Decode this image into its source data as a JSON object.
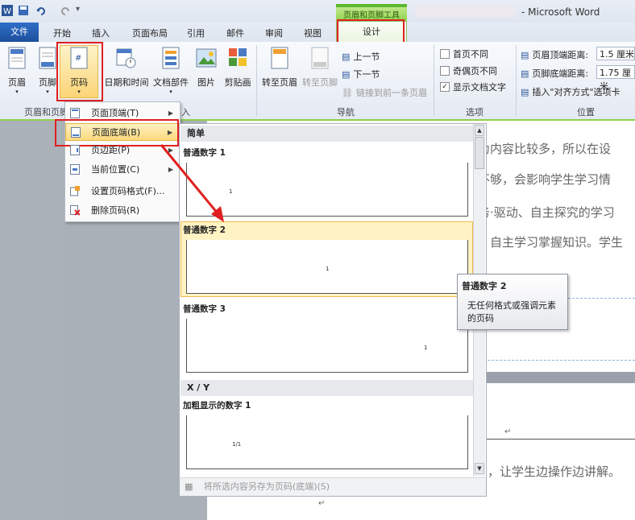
{
  "app": {
    "title": "- Microsoft Word",
    "context_tools_label": "页眉和页脚工具"
  },
  "tabs": {
    "file": "文件",
    "items": [
      "开始",
      "插入",
      "页面布局",
      "引用",
      "邮件",
      "审阅",
      "视图"
    ],
    "design": "设计"
  },
  "ribbon": {
    "header": "页眉",
    "footer": "页脚",
    "page_number": "页码",
    "datetime": "日期和时间",
    "doc_parts": "文档部件",
    "picture": "图片",
    "clipart": "剪贴画",
    "goto_header": "转至页眉",
    "goto_footer": "转至页脚",
    "prev": "上一节",
    "next": "下一节",
    "link_prev": "链接到前一条页眉",
    "group_header_footer": "页眉和页脚",
    "group_insert": "入",
    "group_nav": "导航",
    "opt_first": "首页不同",
    "opt_oddeven": "奇偶页不同",
    "opt_showtext": "显示文档文字",
    "group_options": "选项",
    "header_dist_label": "页眉顶端距离:",
    "header_dist_value": "1.5 厘米",
    "footer_dist_label": "页脚底端距离:",
    "footer_dist_value": "1.75 厘米",
    "insert_align": "插入\"对齐方式\"选项卡",
    "group_position": "位置"
  },
  "menu": [
    {
      "label": "页面顶端(T)",
      "arrow": "▶"
    },
    {
      "label": "页面底端(B)",
      "arrow": "▶"
    },
    {
      "label": "页边距(P)",
      "arrow": "▶"
    },
    {
      "label": "当前位置(C)",
      "arrow": "▶"
    },
    {
      "label": "设置页码格式(F)...",
      "arrow": ""
    },
    {
      "label": "删除页码(R)",
      "arrow": ""
    }
  ],
  "gallery": {
    "cat_simple": "简单",
    "item1": "普通数字 1",
    "item2": "普通数字 2",
    "item3": "普通数字 3",
    "cat_xy": "X / Y",
    "item4": "加粗显示的数字 1",
    "pn1": "1",
    "pn2": "1",
    "pn3": "1",
    "pn4": "1/1",
    "footer_action": "将所选内容另存为页码(底端)(S)"
  },
  "tooltip": {
    "title": "普通数字 2",
    "body_line1": "无任何格式或强调元素",
    "body_line2": "的页码"
  },
  "document": {
    "line1": "为内容比较多，所以在设",
    "line2": "不够，会影响学生学习情",
    "line3": "务·驱动、自主探究的学习",
    "line4": "自主学习掌握知识。学生",
    "line5": "，让学生边操作边讲解。",
    "mark1": "↵",
    "mark2": "↵"
  },
  "colors": {
    "accent_red": "#e02020",
    "ribbon_green": "#8fd14a",
    "file_tab_blue": "#2563b8",
    "menu_highlight": "#fbd97b"
  }
}
